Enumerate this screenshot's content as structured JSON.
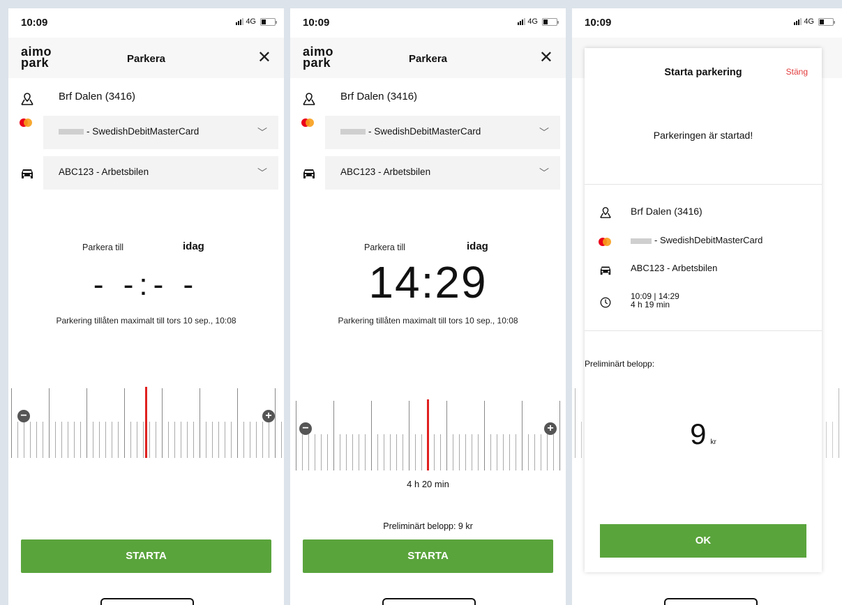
{
  "status": {
    "time": "10:09",
    "network": "4G"
  },
  "header": {
    "logo_line1": "aimo",
    "logo_line2": "park",
    "title": "Parkera"
  },
  "location": "Brf Dalen (3416)",
  "payment": {
    "masked": "••••",
    "label": "- SwedishDebitMasterCard"
  },
  "vehicle": "ABC123 - Arbetsbilen",
  "park_until_label": "Parkera till",
  "park_until_day": "idag",
  "max_note": "Parkering tillåten maximalt till tors 10 sep., 10:08",
  "screen1": {
    "time_placeholder": "- -:- -",
    "button": "STARTA"
  },
  "screen2": {
    "end_time": "14:29",
    "duration": "4 h 20 min",
    "prelim": "Preliminärt belopp:  9 kr",
    "button": "STARTA"
  },
  "modal": {
    "title": "Starta parkering",
    "close": "Stäng",
    "started": "Parkeringen är startad!",
    "location": "Brf Dalen (3416)",
    "payment": "- SwedishDebitMasterCard",
    "vehicle": "ABC123 - Arbetsbilen",
    "time_range": "10:09 | 14:29",
    "time_duration": "4 h 19 min",
    "prelim_label": "Preliminärt belopp:",
    "amount": "9",
    "currency": "kr",
    "ok": "OK"
  },
  "colors": {
    "accent_green": "#5aa43c",
    "ruler_red": "#e02020",
    "close_red": "#e23b3b"
  }
}
